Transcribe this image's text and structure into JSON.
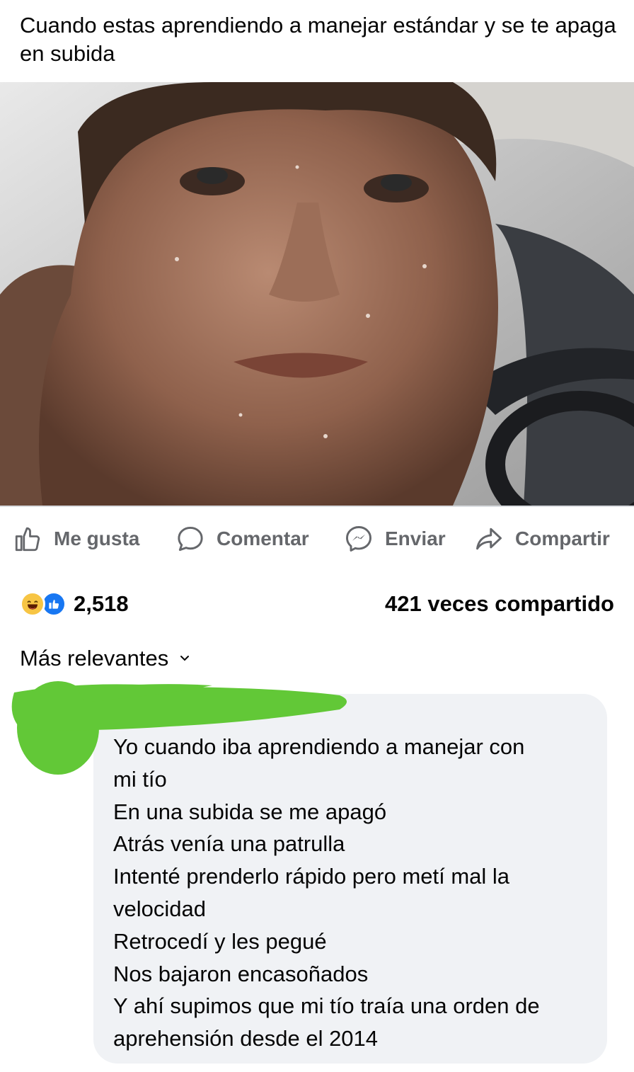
{
  "post": {
    "caption": "Cuando estas aprendiendo a manejar estándar y se te apaga en subida"
  },
  "actions": {
    "like": "Me gusta",
    "comment": "Comentar",
    "send": "Enviar",
    "share": "Compartir"
  },
  "stats": {
    "reaction_count": "2,518",
    "shares": "421 veces compartido"
  },
  "comments": {
    "sort_label": "Más relevantes",
    "first": {
      "lines": [
        "Yo cuando iba aprendiendo a manejar con",
        "mi tío",
        "En una subida se me apagó",
        "Atrás venía una patrulla",
        "Intenté prenderlo rápido pero metí mal la",
        "velocidad",
        "Retrocedí y les pegué",
        "Nos bajaron encasoñados",
        "Y ahí supimos que mi tío traía una orden de",
        "aprehensión desde el 2014"
      ]
    }
  },
  "colors": {
    "action_gray": "#65676b",
    "bubble_bg": "#f0f2f5",
    "like_blue": "#1877f2",
    "haha_yellow": "#f7c544",
    "redaction_green": "#62c837"
  },
  "icons": [
    "thumbs-up-icon",
    "comment-icon",
    "messenger-icon",
    "share-icon",
    "haha-reaction-icon",
    "like-reaction-icon",
    "chevron-down-icon"
  ]
}
